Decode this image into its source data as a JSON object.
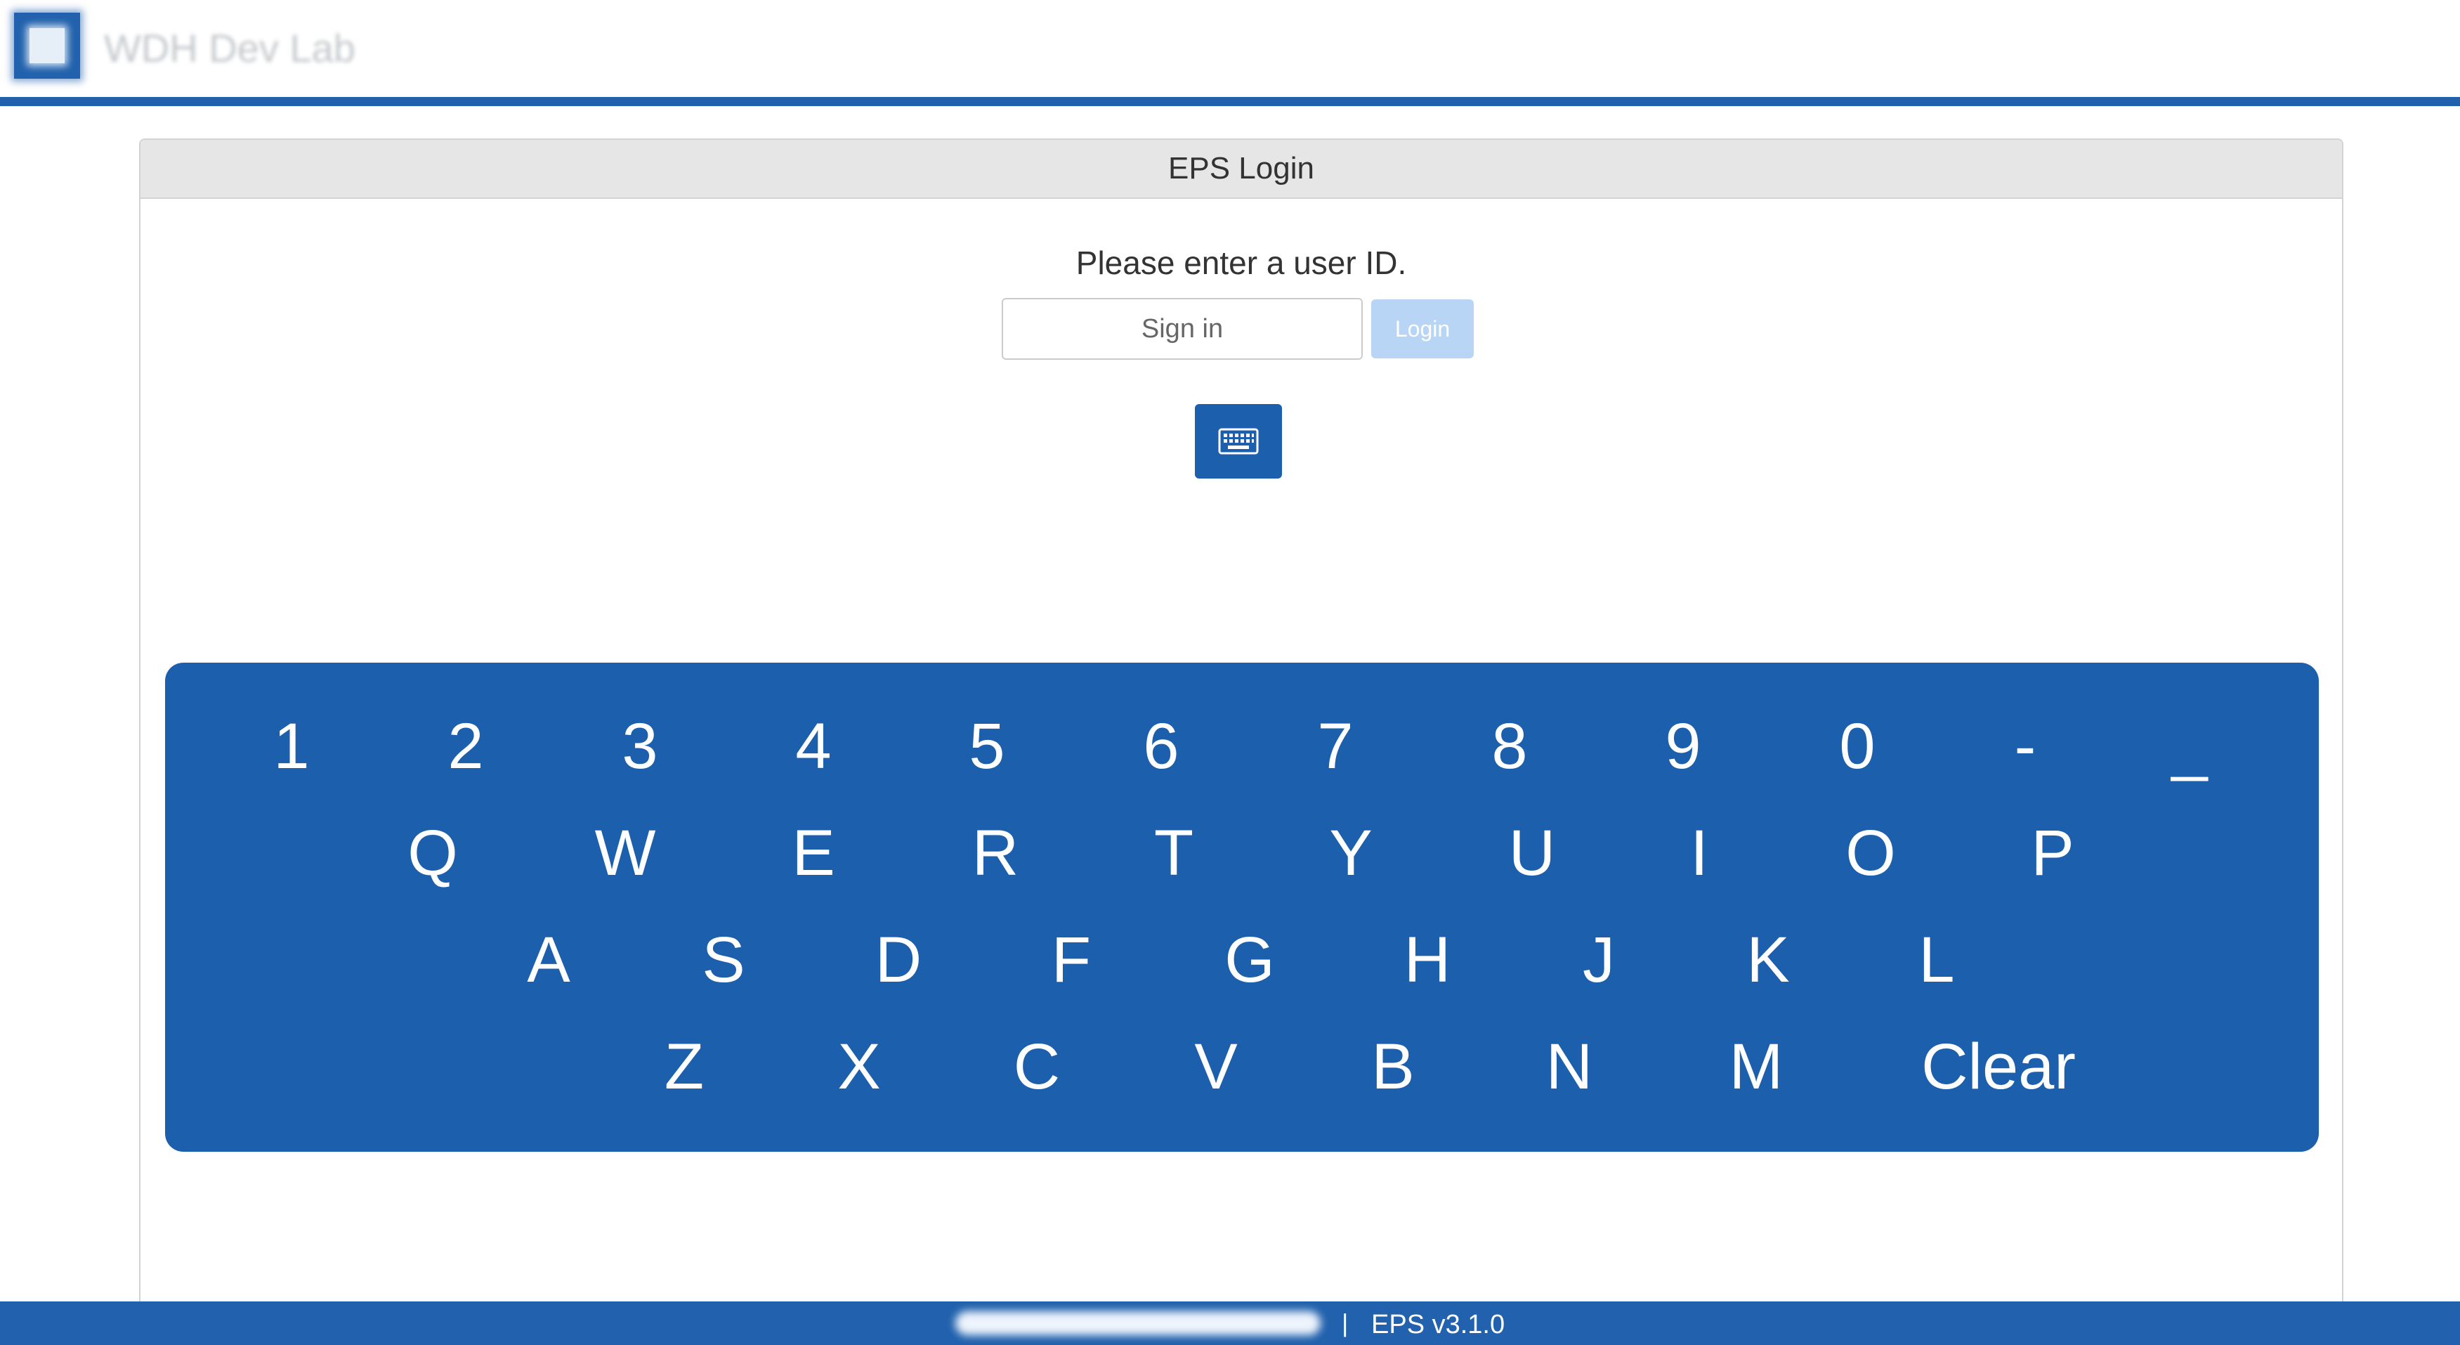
{
  "header": {
    "app_title": "WDH Dev Lab"
  },
  "login_panel": {
    "heading": "EPS Login",
    "prompt": "Please enter a user ID.",
    "signin_placeholder": "Sign in",
    "signin_value": "",
    "login_label": "Login",
    "keyboard_icon": "keyboard-icon"
  },
  "keyboard": {
    "row1": [
      "1",
      "2",
      "3",
      "4",
      "5",
      "6",
      "7",
      "8",
      "9",
      "0",
      "-",
      "_"
    ],
    "row2": [
      "Q",
      "W",
      "E",
      "R",
      "T",
      "Y",
      "U",
      "I",
      "O",
      "P"
    ],
    "row3": [
      "A",
      "S",
      "D",
      "F",
      "G",
      "H",
      "J",
      "K",
      "L"
    ],
    "row4": [
      "Z",
      "X",
      "C",
      "V",
      "B",
      "N",
      "M",
      "Clear"
    ]
  },
  "footer": {
    "separator": "|",
    "version": "EPS v3.1.0"
  },
  "colors": {
    "brand_blue": "#1c5fad",
    "header_rule": "#2161ad",
    "login_disabled": "#b9d5f5"
  }
}
